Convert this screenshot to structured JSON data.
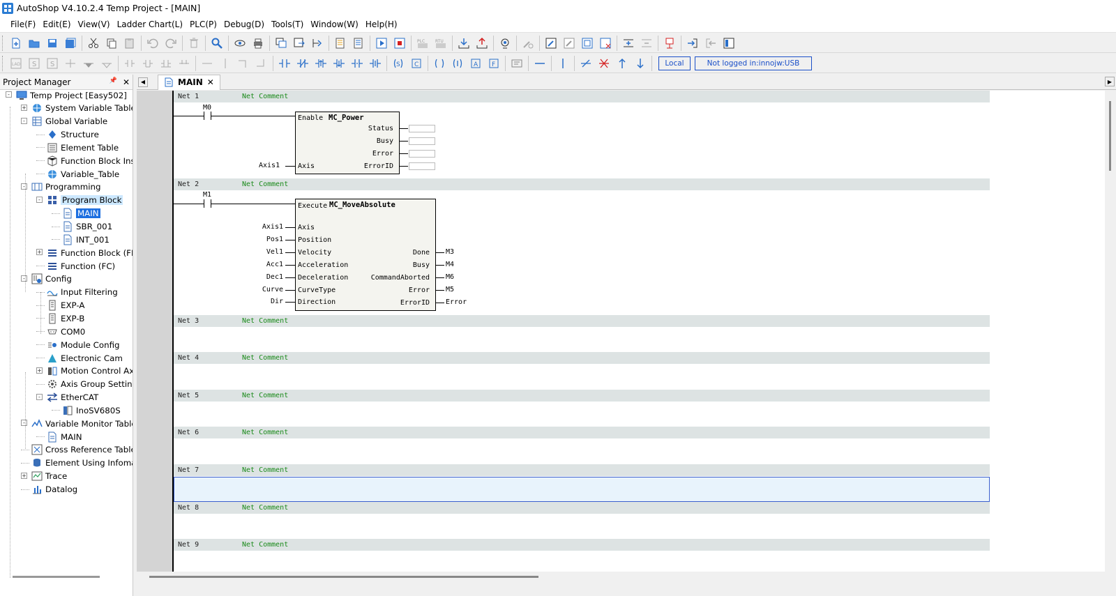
{
  "window": {
    "title": "AutoShop V4.10.2.4  Temp Project - [MAIN]"
  },
  "menu": [
    "File(F)",
    "Edit(E)",
    "View(V)",
    "Ladder Chart(L)",
    "PLC(P)",
    "Debug(D)",
    "Tools(T)",
    "Window(W)",
    "Help(H)"
  ],
  "status": {
    "local_label": "Local",
    "connection_label": "Not logged in:innojw:USB"
  },
  "project_manager": {
    "title": "Project Manager",
    "pin_glyph": "📌",
    "close_glyph": "✕",
    "tree": [
      {
        "label": "Temp Project [Easy502]",
        "icon": "computer-icon"
      },
      {
        "label": "System Variable Table",
        "icon": "globe-icon"
      },
      {
        "label": "Global Variable",
        "icon": "table-icon"
      },
      {
        "label": "Structure",
        "icon": "structure-icon"
      },
      {
        "label": "Element Table",
        "icon": "element-table-icon"
      },
      {
        "label": "Function Block Inst",
        "icon": "cube-icon"
      },
      {
        "label": "Variable_Table",
        "icon": "globe-icon"
      },
      {
        "label": "Programming",
        "icon": "programming-icon"
      },
      {
        "label": "Program Block",
        "icon": "grid-icon"
      },
      {
        "label": "MAIN",
        "icon": "document-icon"
      },
      {
        "label": "SBR_001",
        "icon": "document-icon"
      },
      {
        "label": "INT_001",
        "icon": "document-icon"
      },
      {
        "label": "Function Block (FB)",
        "icon": "list-icon"
      },
      {
        "label": "Function (FC)",
        "icon": "list-icon"
      },
      {
        "label": "Config",
        "icon": "config-icon"
      },
      {
        "label": "Input Filtering",
        "icon": "filter-icon"
      },
      {
        "label": "EXP-A",
        "icon": "module-icon"
      },
      {
        "label": "EXP-B",
        "icon": "module-icon"
      },
      {
        "label": "COM0",
        "icon": "port-icon"
      },
      {
        "label": "Module Config",
        "icon": "module-config-icon"
      },
      {
        "label": "Electronic Cam",
        "icon": "cam-icon"
      },
      {
        "label": "Motion Control Axi",
        "icon": "motion-axis-icon"
      },
      {
        "label": "Axis Group Settings",
        "icon": "gear-icon"
      },
      {
        "label": "EtherCAT",
        "icon": "ethercat-icon"
      },
      {
        "label": "InoSV680S",
        "icon": "servo-icon"
      },
      {
        "label": "Variable Monitor Table",
        "icon": "monitor-icon"
      },
      {
        "label": "MAIN",
        "icon": "document-icon"
      },
      {
        "label": "Cross Reference Table",
        "icon": "cross-ref-icon"
      },
      {
        "label": "Element Using Infomati",
        "icon": "database-icon"
      },
      {
        "label": "Trace",
        "icon": "trace-icon"
      },
      {
        "label": "Datalog",
        "icon": "datalog-icon"
      }
    ]
  },
  "editor": {
    "tab_label": "MAIN",
    "tab_close": "✕",
    "nav_left": "◀",
    "nav_right": "▶",
    "nets": [
      {
        "label": "Net 1",
        "comment": "Net Comment"
      },
      {
        "label": "Net 2",
        "comment": "Net Comment"
      },
      {
        "label": "Net 3",
        "comment": "Net Comment"
      },
      {
        "label": "Net 4",
        "comment": "Net Comment"
      },
      {
        "label": "Net 5",
        "comment": "Net Comment"
      },
      {
        "label": "Net 6",
        "comment": "Net Comment"
      },
      {
        "label": "Net 7",
        "comment": "Net Comment"
      },
      {
        "label": "Net 8",
        "comment": "Net Comment"
      },
      {
        "label": "Net 9",
        "comment": "Net Comment"
      }
    ],
    "net1": {
      "contact": "M0",
      "block_name": "MC_Power",
      "enable_pin": "Enable",
      "axis_pin": "Axis",
      "axis_var": "Axis1",
      "outputs": [
        "Status",
        "Busy",
        "Error",
        "ErrorID"
      ]
    },
    "net2": {
      "contact": "M1",
      "block_name": "MC_MoveAbsolute",
      "execute_pin": "Execute",
      "inputs": [
        {
          "pin": "Axis",
          "var": "Axis1"
        },
        {
          "pin": "Position",
          "var": "Pos1"
        },
        {
          "pin": "Velocity",
          "var": "Vel1"
        },
        {
          "pin": "Acceleration",
          "var": "Acc1"
        },
        {
          "pin": "Deceleration",
          "var": "Dec1"
        },
        {
          "pin": "CurveType",
          "var": "Curve"
        },
        {
          "pin": "Direction",
          "var": "Dir"
        }
      ],
      "outputs": [
        {
          "pin": "Done",
          "var": "M3"
        },
        {
          "pin": "Busy",
          "var": "M4"
        },
        {
          "pin": "CommandAborted",
          "var": "M6"
        },
        {
          "pin": "Error",
          "var": "M5"
        },
        {
          "pin": "ErrorID",
          "var": "Error"
        }
      ]
    }
  }
}
